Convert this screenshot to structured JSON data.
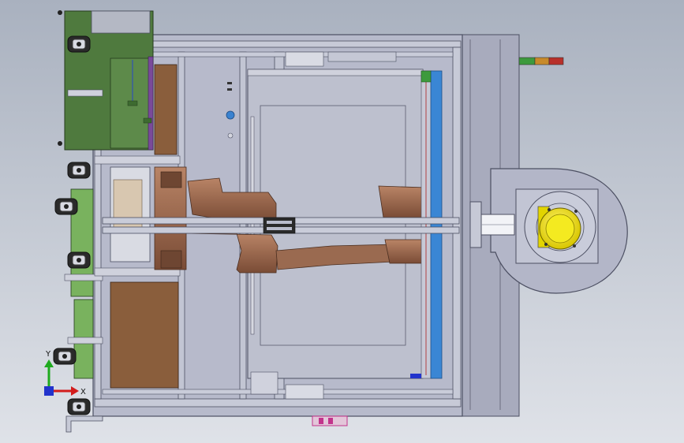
{
  "viewport": {
    "background_top": "#a9b1bf",
    "background_bottom": "#dfe2e8"
  },
  "triad": {
    "y_label": "Y",
    "x_label": "X",
    "y_color": "#1faa1f",
    "x_color": "#d21c1c",
    "z_color": "#2233cc"
  },
  "colors": {
    "frame_fill": "#b9bccb",
    "frame_stroke": "#4c4f62",
    "right_housing": "#a8abbd",
    "panel_green": "#4f7a3e",
    "panel_green_light": "#79b25e",
    "panel_brown": "#8a5e3c",
    "robot_copper": "#9a6a50",
    "robot_copper_dark": "#6e4632",
    "conveyor_blue": "#3a86d4",
    "blower_yellow": "#f0e600",
    "signal_green": "#3d9a3d",
    "signal_amber": "#c88a2a",
    "signal_red": "#b8302a",
    "magenta_part": "#c2348c"
  }
}
